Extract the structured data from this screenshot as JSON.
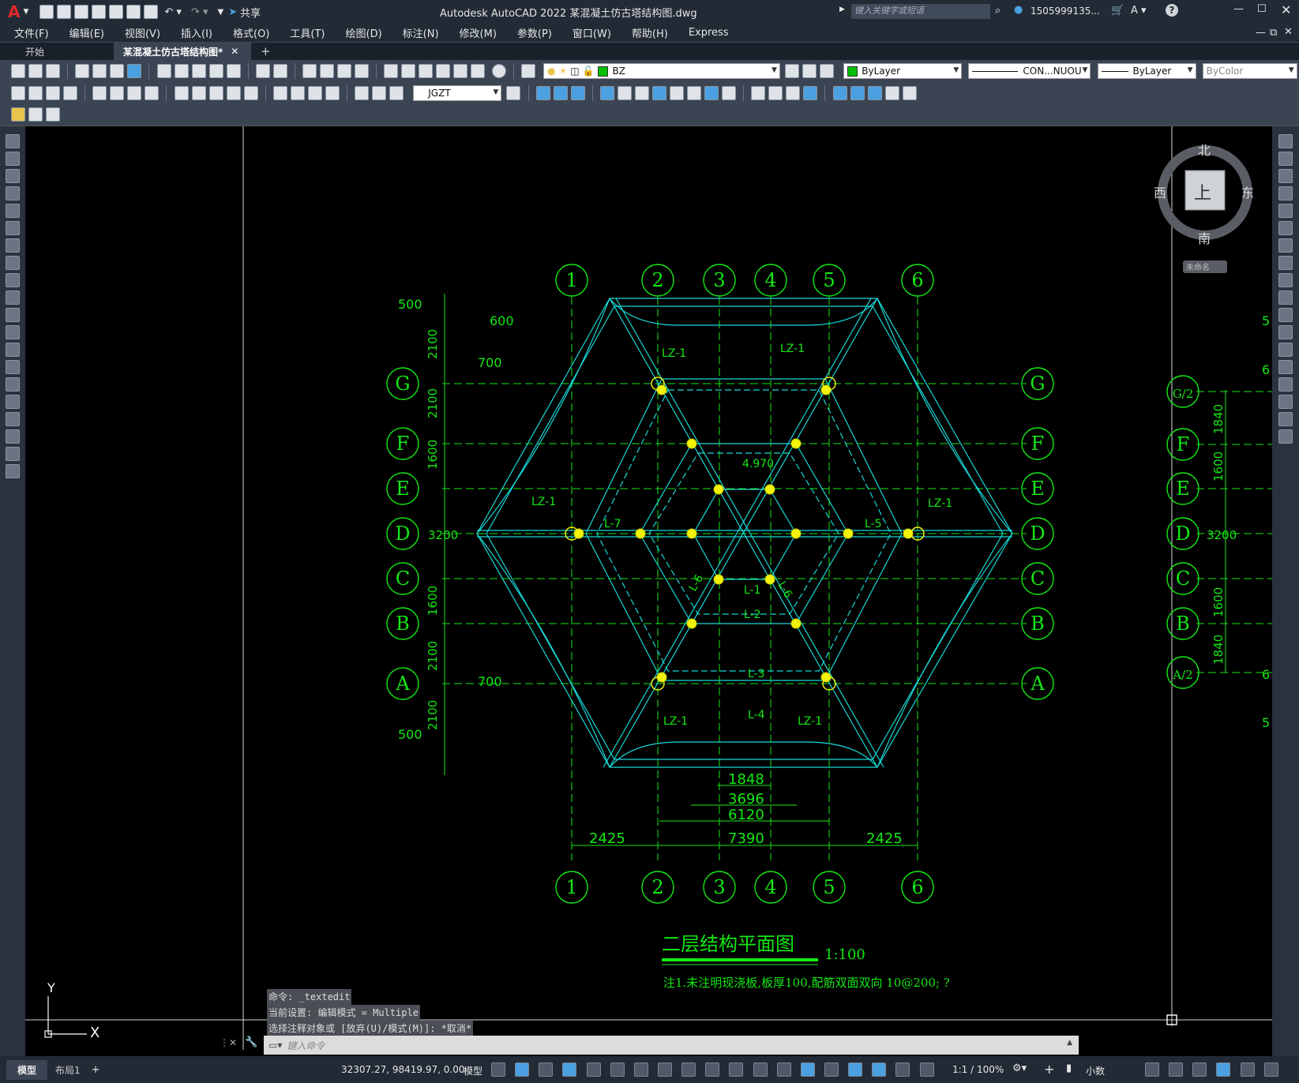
{
  "titlebar": {
    "app_letter": "A",
    "share_label": "共享",
    "title": "Autodesk AutoCAD 2022    某混凝土仿古塔结构图.dwg",
    "search_placeholder": "键入关键字或短语",
    "user": "1505999135...",
    "help": "?"
  },
  "menu": [
    "文件(F)",
    "编辑(E)",
    "视图(V)",
    "插入(I)",
    "格式(O)",
    "工具(T)",
    "绘图(D)",
    "标注(N)",
    "修改(M)",
    "参数(P)",
    "窗口(W)",
    "帮助(H)",
    "Express"
  ],
  "tabs": {
    "start": "开始",
    "doc": "某混凝土仿古塔结构图*",
    "add": "+"
  },
  "toolbar": {
    "layer": "BZ",
    "color": "ByLayer",
    "linetype": "CON...NUOU",
    "lineweight": "ByLayer",
    "plotstyle": "ByColor",
    "textstyle": "JGZT"
  },
  "viewcube": {
    "north": "北",
    "south": "南",
    "east": "东",
    "west": "西",
    "face": "上",
    "wcs": "未命名"
  },
  "drawing": {
    "axes_num": [
      "1",
      "2",
      "3",
      "4",
      "5",
      "6"
    ],
    "axes_let": [
      "G",
      "F",
      "E",
      "D",
      "C",
      "B",
      "A"
    ],
    "right_axes": [
      "G/2",
      "F",
      "E",
      "D",
      "C",
      "B",
      "A/2"
    ],
    "left_dims": [
      "2100",
      "2100",
      "1600",
      "3200",
      "1600",
      "2100",
      "2100"
    ],
    "right_dims": [
      "1840",
      "1600",
      "3200",
      "1600",
      "1840"
    ],
    "left_offsets": [
      "500",
      "600",
      "700",
      "700",
      "500"
    ],
    "bottom_dims": {
      "d1848": "1848",
      "d3696": "3696",
      "d6120": "6120",
      "d7390": "7390",
      "d2425a": "2425",
      "d2425b": "2425"
    },
    "labels": {
      "lz1": "LZ-1",
      "l1": "L-1",
      "l2": "L-2",
      "l3": "L-3",
      "l4": "L-4",
      "l5": "L-5",
      "l6": "L-6",
      "l7": "L-7",
      "elev": "4.970"
    },
    "right_ticks": [
      "5",
      "6",
      "6",
      "5"
    ],
    "title": "二层结构平面图",
    "scale": "1:100",
    "note": "注1.未注明现浇板,板厚100,配筋双面双向 10@200;   ?",
    "ucs_x": "X",
    "ucs_y": "Y"
  },
  "command": {
    "history": [
      "命令: _textedit",
      "当前设置: 编辑模式 = Multiple",
      "选择注释对象或 [放弃(U)/模式(M)]: *取消*"
    ],
    "placeholder": "键入命令"
  },
  "status": {
    "model_tab": "模型",
    "layout_tab": "布局1",
    "coords": "32307.27, 98419.97, 0.00",
    "space": "模型",
    "scale": "1:1 / 100%",
    "units": "小数"
  }
}
